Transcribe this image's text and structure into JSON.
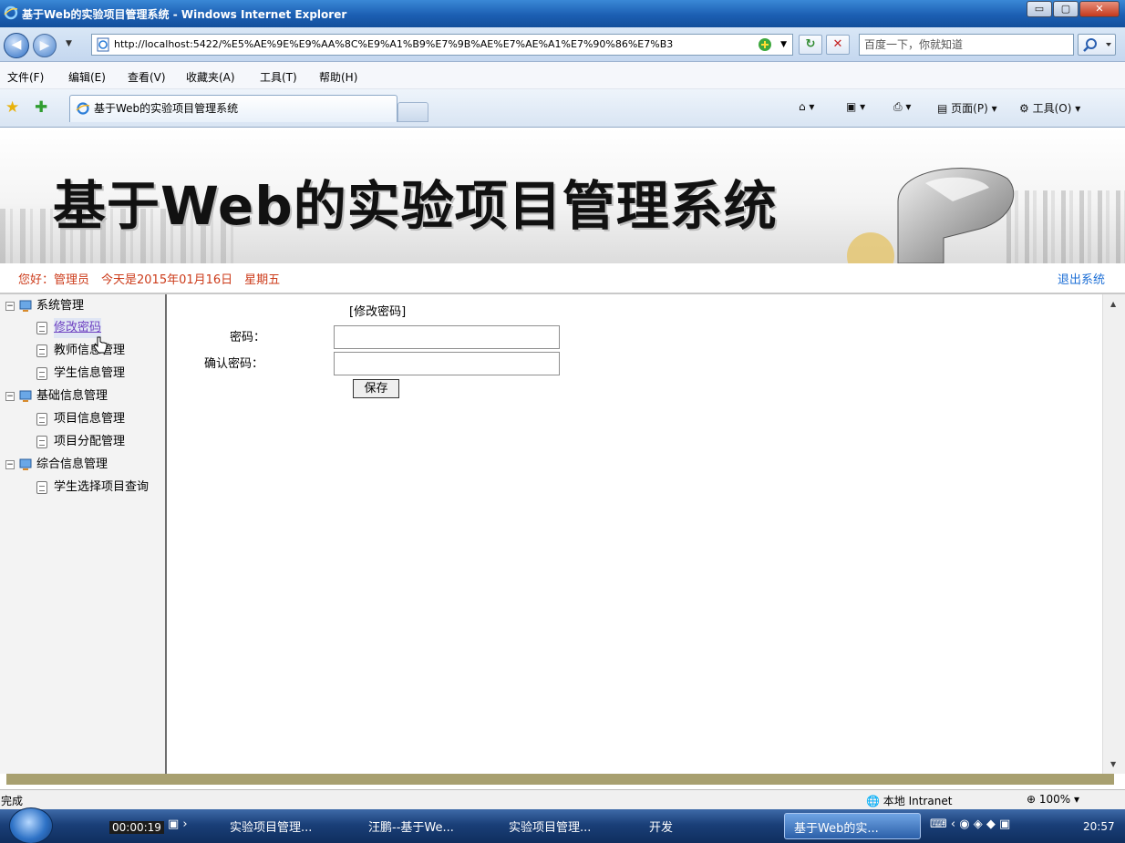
{
  "window": {
    "title": "基于Web的实验项目管理系统 - Windows Internet Explorer",
    "min_label": "▭",
    "max_label": "▢",
    "close_label": "✕"
  },
  "addressbar": {
    "url": "http://localhost:5422/%E5%AE%9E%E9%AA%8C%E9%A1%B9%E7%9B%AE%E7%AE%A1%E7%90%86%E7%B3",
    "search_placeholder": "百度一下，你就知道"
  },
  "menubar": {
    "items": [
      "文件(F)",
      "编辑(E)",
      "查看(V)",
      "收藏夹(A)",
      "工具(T)",
      "帮助(H)"
    ]
  },
  "tabbar": {
    "tab_title": "基于Web的实验项目管理系统",
    "page_menu": "页面(P)",
    "tools_menu": "工具(O)"
  },
  "header": {
    "system_title": "基于Web的实验项目管理系统"
  },
  "infobar": {
    "greeting": "您好：管理员　今天是2015年01月16日　星期五",
    "logout": "退出系统"
  },
  "sidebar": {
    "groups": [
      {
        "label": "系统管理",
        "items": [
          "修改密码",
          "教师信息管理",
          "学生信息管理"
        ]
      },
      {
        "label": "基础信息管理",
        "items": [
          "项目信息管理",
          "项目分配管理"
        ]
      },
      {
        "label": "综合信息管理",
        "items": [
          "学生选择项目查询"
        ]
      }
    ]
  },
  "form": {
    "caption": "[修改密码]",
    "password_label": "密码：",
    "confirm_label": "确认密码：",
    "password_value": "",
    "confirm_value": "",
    "save_label": "保存"
  },
  "statusbar": {
    "status": "完成",
    "zone": "本地 Intranet",
    "zoom": "100%"
  },
  "taskbar": {
    "recording_time": "00:00:19",
    "tasks": [
      "实验项目管理...",
      "汪鹏--基于We...",
      "实验项目管理...",
      "开发",
      "基于Web的实..."
    ],
    "clock": "20:57"
  },
  "colors": {
    "greeting": "#cc3b1a",
    "logout": "#1d6fd6",
    "active_link": "#6f42c1",
    "divider": "#a8a070"
  }
}
